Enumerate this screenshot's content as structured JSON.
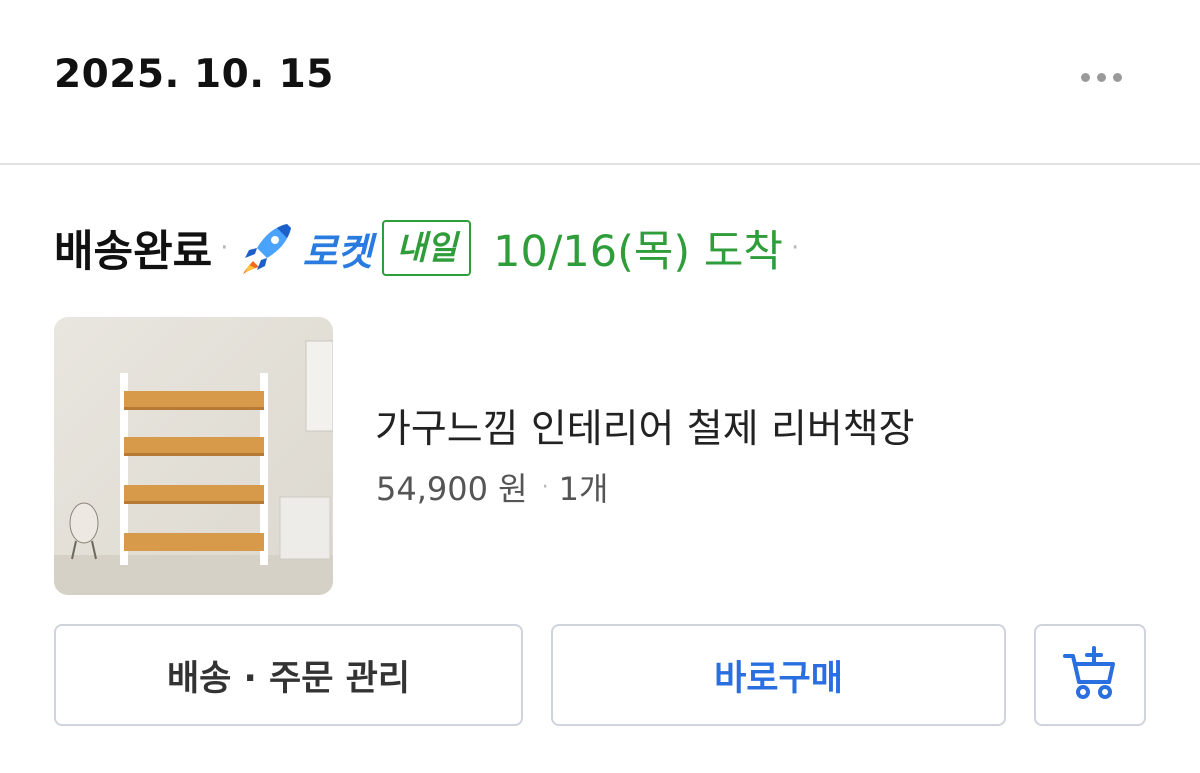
{
  "order": {
    "date": "2025. 10. 15",
    "status": "배송완료",
    "rocket_label": "로켓",
    "delivery_badge": "내일",
    "arrival_text": "10/16(목) 도착",
    "separator": "·"
  },
  "product": {
    "name": "가구느낌 인테리어 철제 리버책장",
    "price": "54,900 원",
    "quantity": "1개",
    "image_icon": "bookshelf-product-image"
  },
  "actions": {
    "manage_label": "배송 · 주문 관리",
    "buy_again_label": "바로구매",
    "cart_icon": "add-to-cart-icon"
  },
  "colors": {
    "rocket_blue": "#2a7be0",
    "arrival_green": "#2f9d3a",
    "buy_blue": "#2a6fe0"
  }
}
